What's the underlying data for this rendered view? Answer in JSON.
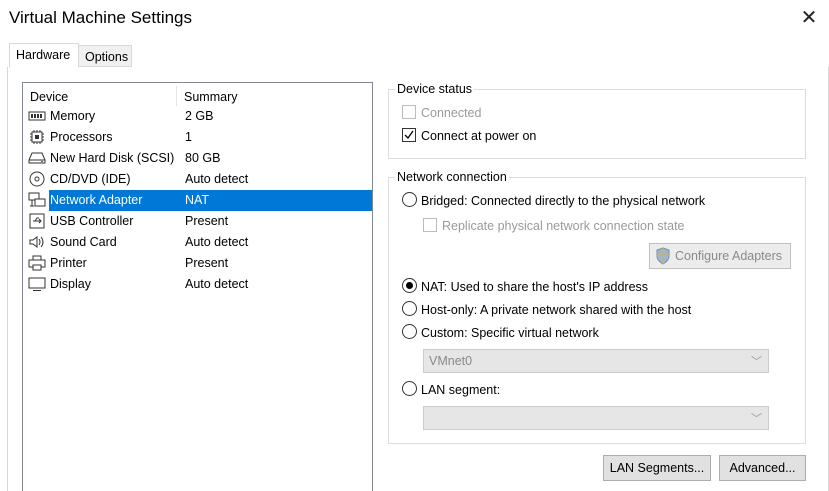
{
  "window": {
    "title": "Virtual Machine Settings",
    "close_glyph": "✕"
  },
  "tabs": [
    {
      "label": "Hardware"
    },
    {
      "label": "Options"
    }
  ],
  "device_list": {
    "headers": {
      "device": "Device",
      "summary": "Summary"
    },
    "rows": [
      {
        "name": "Memory",
        "summary": "2 GB",
        "icon": "memory-icon"
      },
      {
        "name": "Processors",
        "summary": "1",
        "icon": "processor-icon"
      },
      {
        "name": "New Hard Disk (SCSI)",
        "summary": "80 GB",
        "icon": "hard-disk-icon"
      },
      {
        "name": "CD/DVD (IDE)",
        "summary": "Auto detect",
        "icon": "cd-dvd-icon"
      },
      {
        "name": "Network Adapter",
        "summary": "NAT",
        "icon": "network-adapter-icon",
        "selected": true
      },
      {
        "name": "USB Controller",
        "summary": "Present",
        "icon": "usb-icon"
      },
      {
        "name": "Sound Card",
        "summary": "Auto detect",
        "icon": "speaker-icon"
      },
      {
        "name": "Printer",
        "summary": "Present",
        "icon": "printer-icon"
      },
      {
        "name": "Display",
        "summary": "Auto detect",
        "icon": "display-icon"
      }
    ]
  },
  "device_status": {
    "title": "Device status",
    "connected": {
      "label": "Connected",
      "checked": false,
      "disabled": true
    },
    "connect_at_power_on": {
      "label": "Connect at power on",
      "checked": true
    }
  },
  "network_connection": {
    "title": "Network connection",
    "bridged": {
      "label": "Bridged: Connected directly to the physical network",
      "selected": false
    },
    "replicate": {
      "label": "Replicate physical network connection state",
      "checked": false,
      "disabled": true
    },
    "configure_adapters": {
      "label": "Configure Adapters",
      "disabled": true,
      "icon": "shield-icon"
    },
    "nat": {
      "label": "NAT: Used to share the host's IP address",
      "selected": true
    },
    "host_only": {
      "label": "Host-only: A private network shared with the host",
      "selected": false
    },
    "custom": {
      "label": "Custom: Specific virtual network",
      "selected": false
    },
    "vmnet_select": {
      "value": "VMnet0",
      "disabled": true
    },
    "lan_segment": {
      "label": "LAN segment:",
      "selected": false
    },
    "lan_select": {
      "value": "",
      "disabled": true
    }
  },
  "buttons": {
    "lan_segments": "LAN Segments...",
    "advanced": "Advanced..."
  },
  "colors": {
    "selection": "#0078d7",
    "border": "#d9d9d9"
  }
}
